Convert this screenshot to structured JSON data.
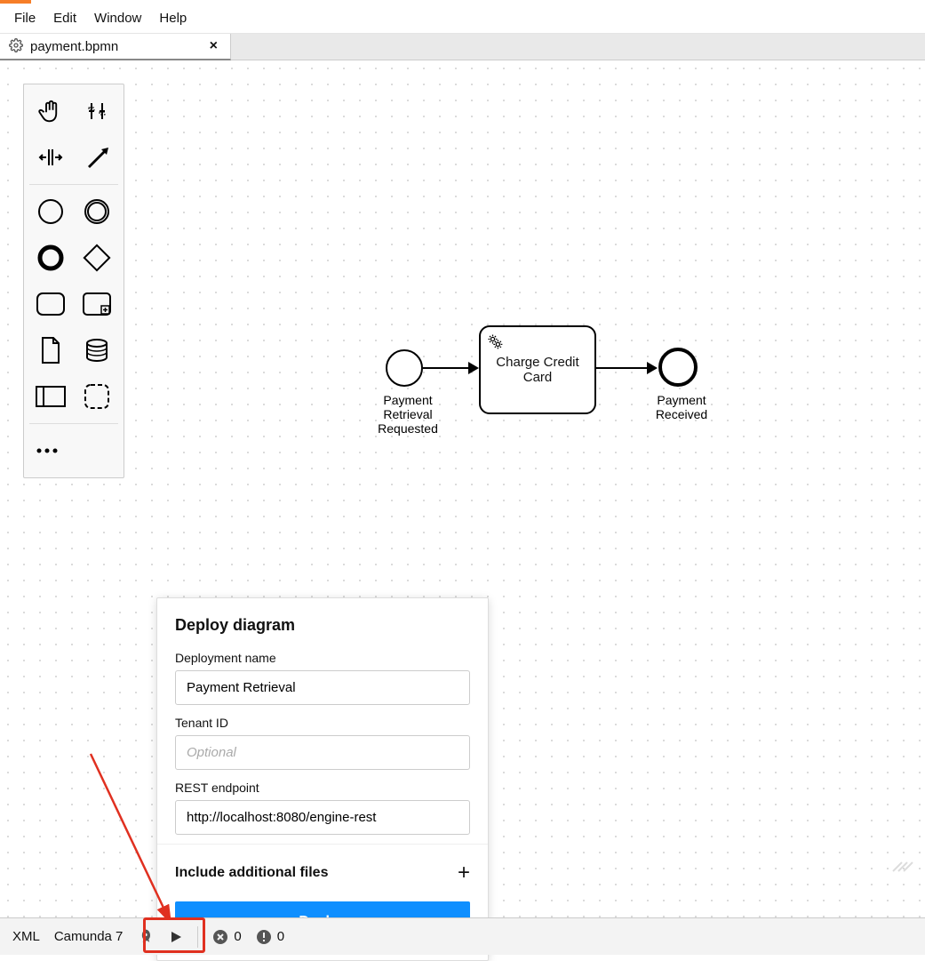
{
  "menu": {
    "items": [
      "File",
      "Edit",
      "Window",
      "Help"
    ]
  },
  "tab": {
    "title": "payment.bpmn"
  },
  "diagram": {
    "start_label": "Payment Retrieval Requested",
    "task_label": "Charge Credit Card",
    "end_label": "Payment Received"
  },
  "deploy": {
    "title": "Deploy diagram",
    "name_label": "Deployment name",
    "name_value": "Payment Retrieval",
    "tenant_label": "Tenant ID",
    "tenant_placeholder": "Optional",
    "tenant_value": "",
    "endpoint_label": "REST endpoint",
    "endpoint_value": "http://localhost:8080/engine-rest",
    "include_label": "Include additional files",
    "button_label": "Deploy"
  },
  "statusbar": {
    "xml": "XML",
    "engine": "Camunda 7",
    "errors": "0",
    "warnings": "0"
  },
  "palette": {
    "tools": [
      "hand-tool",
      "lasso-tool",
      "space-tool",
      "global-connect-tool",
      "start-event",
      "intermediate-event",
      "end-event",
      "gateway",
      "task",
      "subprocess-expanded",
      "data-object",
      "data-store",
      "participant",
      "group",
      "more"
    ]
  }
}
